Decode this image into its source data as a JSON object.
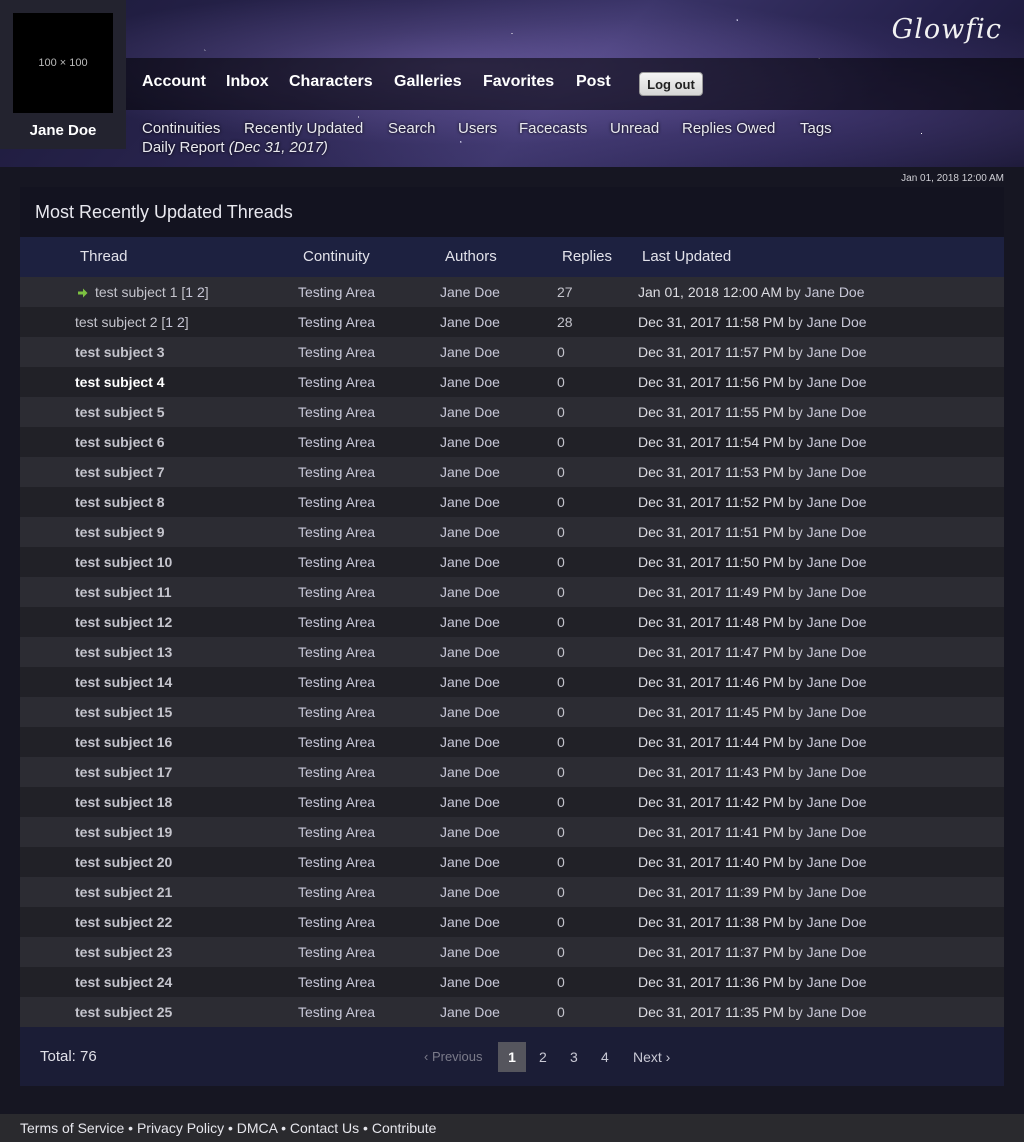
{
  "header": {
    "logo": "Glowfic",
    "avatar_placeholder": "100 × 100",
    "username": "Jane Doe",
    "nav": [
      "Account",
      "Inbox",
      "Characters",
      "Galleries",
      "Favorites",
      "Post"
    ],
    "logout_label": "Log out",
    "subnav": [
      "Continuities",
      "Recently Updated",
      "Search",
      "Users",
      "Facecasts",
      "Unread",
      "Replies Owed",
      "Tags"
    ],
    "daily_report_label": "Daily Report",
    "daily_report_date": "(Dec 31, 2017)",
    "server_time": "Jan 01, 2018 12:00 AM"
  },
  "table": {
    "title": "Most Recently Updated Threads",
    "columns": [
      "Thread",
      "Continuity",
      "Authors",
      "Replies",
      "Last Updated"
    ],
    "by_label": "by",
    "rows": [
      {
        "subject": "test subject 1",
        "pages": [
          "1",
          "2"
        ],
        "continuity": "Testing Area",
        "authors": "Jane Doe",
        "replies": "27",
        "updated": "Jan 01, 2018 12:00 AM",
        "by": "Jane Doe",
        "unread_arrow": true
      },
      {
        "subject": "test subject 2",
        "pages": [
          "1",
          "2"
        ],
        "continuity": "Testing Area",
        "authors": "Jane Doe",
        "replies": "28",
        "updated": "Dec 31, 2017 11:58 PM",
        "by": "Jane Doe"
      },
      {
        "subject": "test subject 3",
        "continuity": "Testing Area",
        "authors": "Jane Doe",
        "replies": "0",
        "updated": "Dec 31, 2017 11:57 PM",
        "by": "Jane Doe"
      },
      {
        "subject": "test subject 4",
        "continuity": "Testing Area",
        "authors": "Jane Doe",
        "replies": "0",
        "updated": "Dec 31, 2017 11:56 PM",
        "by": "Jane Doe"
      },
      {
        "subject": "test subject 5",
        "continuity": "Testing Area",
        "authors": "Jane Doe",
        "replies": "0",
        "updated": "Dec 31, 2017 11:55 PM",
        "by": "Jane Doe"
      },
      {
        "subject": "test subject 6",
        "continuity": "Testing Area",
        "authors": "Jane Doe",
        "replies": "0",
        "updated": "Dec 31, 2017 11:54 PM",
        "by": "Jane Doe"
      },
      {
        "subject": "test subject 7",
        "continuity": "Testing Area",
        "authors": "Jane Doe",
        "replies": "0",
        "updated": "Dec 31, 2017 11:53 PM",
        "by": "Jane Doe"
      },
      {
        "subject": "test subject 8",
        "continuity": "Testing Area",
        "authors": "Jane Doe",
        "replies": "0",
        "updated": "Dec 31, 2017 11:52 PM",
        "by": "Jane Doe"
      },
      {
        "subject": "test subject 9",
        "continuity": "Testing Area",
        "authors": "Jane Doe",
        "replies": "0",
        "updated": "Dec 31, 2017 11:51 PM",
        "by": "Jane Doe"
      },
      {
        "subject": "test subject 10",
        "continuity": "Testing Area",
        "authors": "Jane Doe",
        "replies": "0",
        "updated": "Dec 31, 2017 11:50 PM",
        "by": "Jane Doe"
      },
      {
        "subject": "test subject 11",
        "continuity": "Testing Area",
        "authors": "Jane Doe",
        "replies": "0",
        "updated": "Dec 31, 2017 11:49 PM",
        "by": "Jane Doe"
      },
      {
        "subject": "test subject 12",
        "continuity": "Testing Area",
        "authors": "Jane Doe",
        "replies": "0",
        "updated": "Dec 31, 2017 11:48 PM",
        "by": "Jane Doe"
      },
      {
        "subject": "test subject 13",
        "continuity": "Testing Area",
        "authors": "Jane Doe",
        "replies": "0",
        "updated": "Dec 31, 2017 11:47 PM",
        "by": "Jane Doe"
      },
      {
        "subject": "test subject 14",
        "continuity": "Testing Area",
        "authors": "Jane Doe",
        "replies": "0",
        "updated": "Dec 31, 2017 11:46 PM",
        "by": "Jane Doe"
      },
      {
        "subject": "test subject 15",
        "continuity": "Testing Area",
        "authors": "Jane Doe",
        "replies": "0",
        "updated": "Dec 31, 2017 11:45 PM",
        "by": "Jane Doe"
      },
      {
        "subject": "test subject 16",
        "continuity": "Testing Area",
        "authors": "Jane Doe",
        "replies": "0",
        "updated": "Dec 31, 2017 11:44 PM",
        "by": "Jane Doe"
      },
      {
        "subject": "test subject 17",
        "continuity": "Testing Area",
        "authors": "Jane Doe",
        "replies": "0",
        "updated": "Dec 31, 2017 11:43 PM",
        "by": "Jane Doe"
      },
      {
        "subject": "test subject 18",
        "continuity": "Testing Area",
        "authors": "Jane Doe",
        "replies": "0",
        "updated": "Dec 31, 2017 11:42 PM",
        "by": "Jane Doe"
      },
      {
        "subject": "test subject 19",
        "continuity": "Testing Area",
        "authors": "Jane Doe",
        "replies": "0",
        "updated": "Dec 31, 2017 11:41 PM",
        "by": "Jane Doe"
      },
      {
        "subject": "test subject 20",
        "continuity": "Testing Area",
        "authors": "Jane Doe",
        "replies": "0",
        "updated": "Dec 31, 2017 11:40 PM",
        "by": "Jane Doe"
      },
      {
        "subject": "test subject 21",
        "continuity": "Testing Area",
        "authors": "Jane Doe",
        "replies": "0",
        "updated": "Dec 31, 2017 11:39 PM",
        "by": "Jane Doe"
      },
      {
        "subject": "test subject 22",
        "continuity": "Testing Area",
        "authors": "Jane Doe",
        "replies": "0",
        "updated": "Dec 31, 2017 11:38 PM",
        "by": "Jane Doe"
      },
      {
        "subject": "test subject 23",
        "continuity": "Testing Area",
        "authors": "Jane Doe",
        "replies": "0",
        "updated": "Dec 31, 2017 11:37 PM",
        "by": "Jane Doe"
      },
      {
        "subject": "test subject 24",
        "continuity": "Testing Area",
        "authors": "Jane Doe",
        "replies": "0",
        "updated": "Dec 31, 2017 11:36 PM",
        "by": "Jane Doe"
      },
      {
        "subject": "test subject 25",
        "continuity": "Testing Area",
        "authors": "Jane Doe",
        "replies": "0",
        "updated": "Dec 31, 2017 11:35 PM",
        "by": "Jane Doe"
      }
    ]
  },
  "pagination": {
    "total": "Total: 76",
    "previous": "‹ Previous",
    "pages": [
      "1",
      "2",
      "3",
      "4"
    ],
    "current": "1",
    "next": "Next ›"
  },
  "footer": {
    "links": [
      "Terms of Service",
      "Privacy Policy",
      "DMCA",
      "Contact Us",
      "Contribute"
    ],
    "separator": "•"
  },
  "colors": {
    "row_odd": "#2c2c33",
    "row_even": "#212127",
    "header_bar": "#1d2140",
    "unread_arrow": "#7dc242"
  }
}
